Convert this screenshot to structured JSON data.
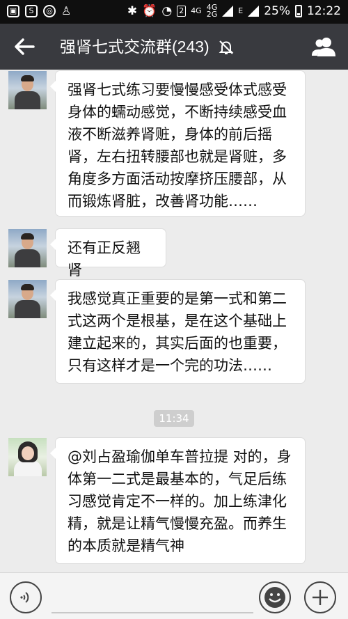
{
  "status_bar": {
    "network_labels": [
      "4G",
      "4G",
      "2G",
      "E"
    ],
    "sim_badge": "2",
    "battery": "25%",
    "time": "12:22",
    "left_icons": [
      "image-icon",
      "s-app-icon",
      "camera-app-icon",
      "person-icon"
    ]
  },
  "header": {
    "title": "强肾七式交流群(243)",
    "back_icon": "back-arrow-icon",
    "mute_icon": "muted-bell-icon",
    "members_icon": "group-members-icon"
  },
  "messages": [
    {
      "avatar": "man-avatar",
      "text": "强肾七式练习要慢慢感受体式感受身体的蠕动感觉，不断持续感受血液不断滋养肾赃，身体的前后摇肾，左右扭转腰部也就是肾赃，多角度多方面活动按摩挤压腰部，从而锻炼肾脏，改善肾功能……"
    },
    {
      "avatar": "man-avatar",
      "text": "还有正反翘肾"
    },
    {
      "avatar": "man-avatar",
      "text": "我感觉真正重要的是第一式和第二式这两个是根基，是在这个基础上建立起来的，其实后面的也重要，只有这样才是一个完的功法……"
    },
    {
      "avatar": "woman-avatar",
      "text": "@刘占盈瑜伽单车普拉提 对的，身体第一二式是最基本的，气足后练习感觉肯定不一样的。加上练津化精，就是让精气慢慢充盈。而养生的本质就是精气神"
    }
  ],
  "timestamp": "11:34",
  "input_bar": {
    "voice_icon": "voice-input-icon",
    "emoji_icon": "emoji-icon",
    "more_icon": "plus-icon"
  },
  "colors": {
    "header_bg": "#393a3f",
    "status_bg": "#0f0f0f",
    "chat_bg": "#ececec"
  }
}
